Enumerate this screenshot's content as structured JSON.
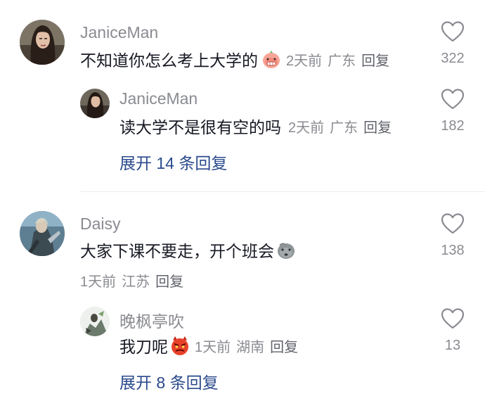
{
  "comments": [
    {
      "username": "JaniceMan",
      "text": "不知道你怎么考上大学的",
      "emoji": "pink-blob-face-icon",
      "time": "2天前",
      "location": "广东",
      "reply": "回复",
      "likes": "322",
      "replies": [
        {
          "username": "JaniceMan",
          "text": "读大学不是很有空的吗",
          "time": "2天前",
          "location": "广东",
          "reply": "回复",
          "likes": "182"
        }
      ],
      "expand": "展开 14 条回复"
    },
    {
      "username": "Daisy",
      "text": "大家下课不要走，开个班会",
      "emoji": "gray-blob-face-icon",
      "time": "1天前",
      "location": "江苏",
      "reply": "回复",
      "likes": "138",
      "replies": [
        {
          "username": "晚枫亭吹",
          "text": "我刀呢",
          "emoji": "angry-devil-face-icon",
          "time": "1天前",
          "location": "湖南",
          "reply": "回复",
          "likes": "13"
        }
      ],
      "expand": "展开 8 条回复"
    }
  ],
  "colors": {
    "text": "#161823",
    "meta": "#8a8b91",
    "expand": "#2a4a8c",
    "divider": "#ececec"
  }
}
